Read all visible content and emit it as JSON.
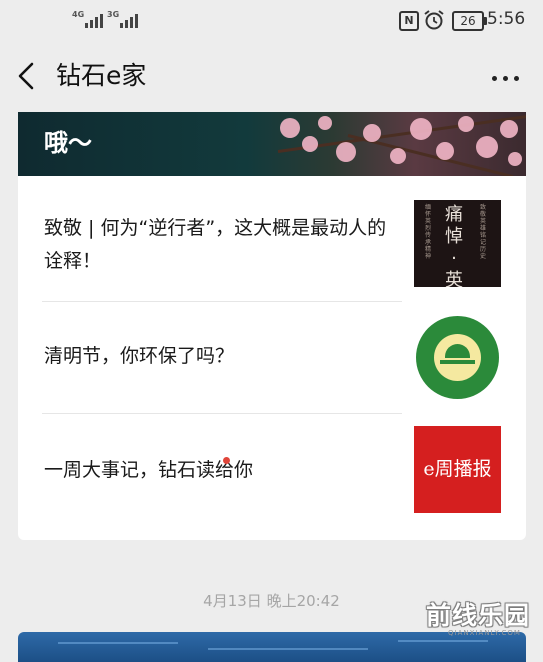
{
  "status_bar": {
    "signal_1": "4G",
    "signal_2": "3G",
    "nfc_glyph": "N",
    "battery": "26",
    "time": "5:56"
  },
  "nav": {
    "title": "钻石e家",
    "back_icon": "chevron-left-icon",
    "more_icon": "more-dots-icon"
  },
  "banner": {
    "partial_text": "哦～"
  },
  "articles": [
    {
      "title": "致敬 | 何为“逆行者”，这大概是最动人的诠释！",
      "thumb": "痛悼·英雄"
    },
    {
      "title": "清明节，你环保了吗？",
      "thumb": "environment-logo"
    },
    {
      "title": "一周大事记，钻石读给你",
      "thumb": "e周播报"
    }
  ],
  "timestamp": "4月13日 晚上20:42",
  "watermark": {
    "main": "前线乐园",
    "sub": "QIANXIANLY.COM"
  },
  "colors": {
    "background": "#ededed",
    "card": "#ffffff",
    "thumb_red": "#d51f1f",
    "thumb_green": "#2b8a3a"
  }
}
